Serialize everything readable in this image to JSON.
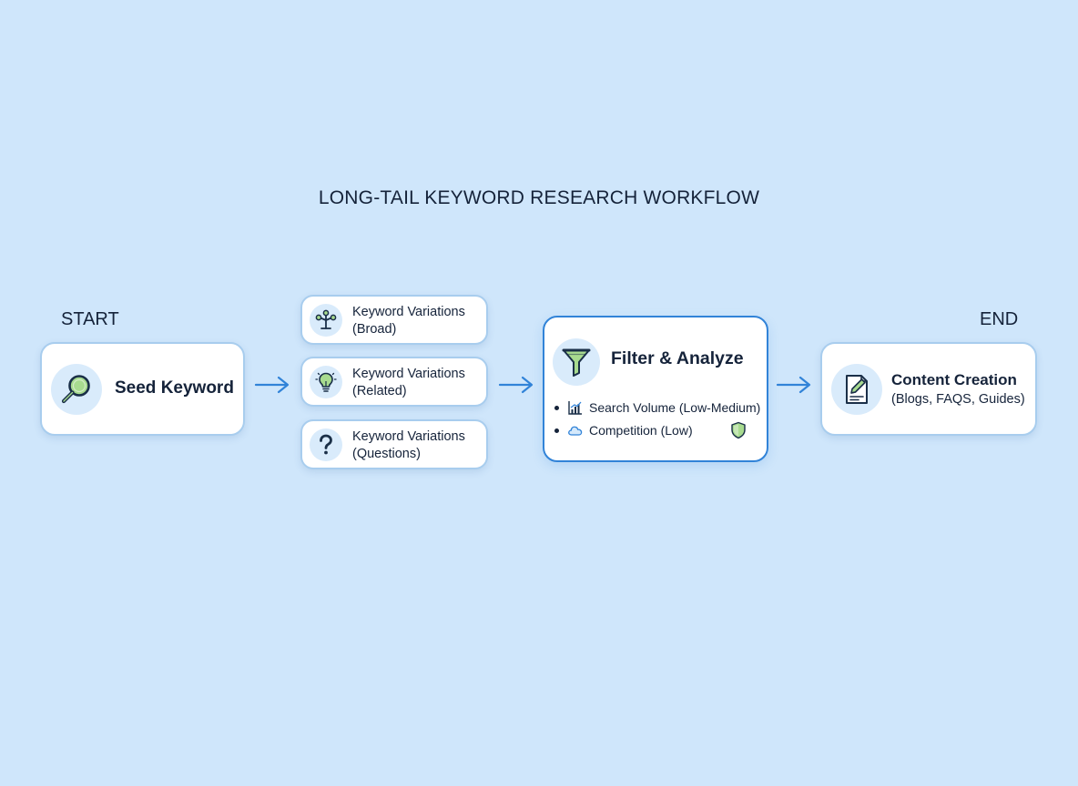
{
  "diagram": {
    "title": "LONG-TAIL KEYWORD RESEARCH WORKFLOW",
    "start_label": "START",
    "end_label": "END"
  },
  "nodes": {
    "seed": {
      "label": "Seed Keyword",
      "icon": "magnifier-icon"
    },
    "variations": [
      {
        "line1": "Keyword Variations",
        "line2": "(Broad)",
        "icon": "branch-icon"
      },
      {
        "line1": "Keyword Variations",
        "line2": "(Related)",
        "icon": "lightbulb-icon"
      },
      {
        "line1": "Keyword Variations",
        "line2": "(Questions)",
        "icon": "question-icon"
      }
    ],
    "filter": {
      "title": "Filter & Analyze",
      "icon": "funnel-icon",
      "criteria": [
        {
          "text": "Search Volume (Low-Medium)",
          "icon": "bar-chart-icon"
        },
        {
          "text": "Competition (Low)",
          "icon": "cloud-icon"
        }
      ],
      "badge_icon": "shield-icon"
    },
    "content": {
      "title": "Content Creation",
      "subtitle": "(Blogs, FAQS, Guides)",
      "icon": "document-pen-icon"
    }
  },
  "colors": {
    "background": "#cfe6fb",
    "accent_blue": "#3183d8",
    "icon_green": "#a8db8f",
    "icon_dark": "#1a2f48",
    "card_border": "#a8cdee"
  }
}
